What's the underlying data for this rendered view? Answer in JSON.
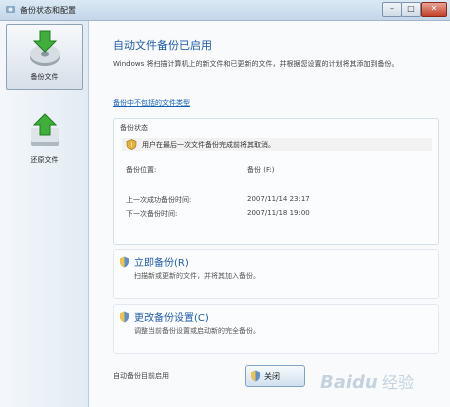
{
  "window": {
    "title": "备份状态和配置"
  },
  "sidebar": {
    "items": [
      {
        "label": "备份文件",
        "icon": "backup-files-icon",
        "selected": true
      },
      {
        "label": "还原文件",
        "icon": "restore-files-icon",
        "selected": false
      }
    ]
  },
  "main": {
    "heading": "自动文件备份已启用",
    "description": "Windows 将扫描计算机上的新文件和已更新的文件，并根据您设置的计划将其添加到备份。",
    "link": "备份中不包括的文件类型",
    "status": {
      "title": "备份状态",
      "warning": "用户在最后一次文件备份完成前将其取消。",
      "rows": [
        {
          "label": "备份位置:",
          "value": "备份 (F:)"
        },
        {
          "label": "上一次成功备份时间:",
          "value": "2007/11/14 23:17"
        },
        {
          "label": "下一次备份时间:",
          "value": "2007/11/18 19:00"
        }
      ]
    },
    "actions": [
      {
        "title": "立即备份(R)",
        "description": "扫描新或更新的文件，并将其加入备份。"
      },
      {
        "title": "更改备份设置(C)",
        "description": "调整当前备份设置或启动新的完全备份。"
      }
    ],
    "footer": {
      "label": "自动备份目前启用",
      "button": "关闭"
    }
  },
  "colors": {
    "accent": "#1e5aa8",
    "link": "#1560bd",
    "background": "#eef4f9"
  },
  "watermark": "Baidu 经验"
}
